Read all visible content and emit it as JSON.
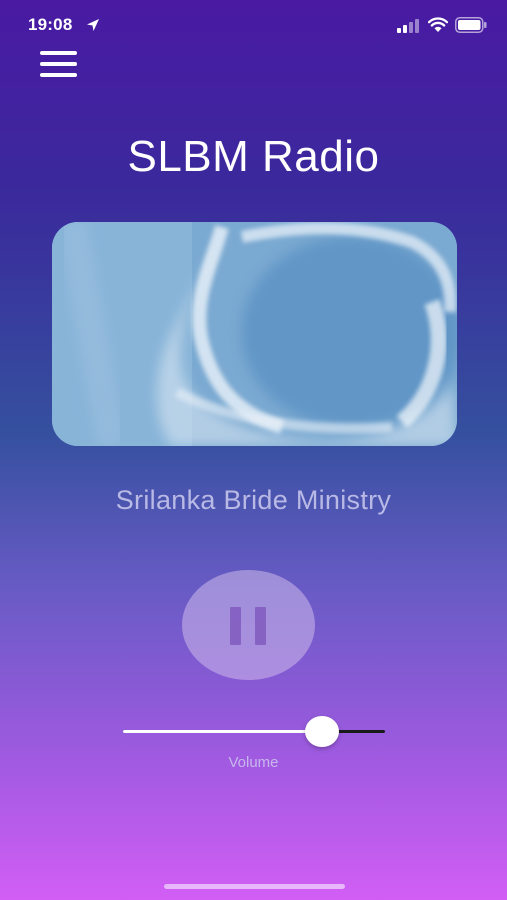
{
  "status_bar": {
    "time": "19:08",
    "location_icon": "location-arrow-icon",
    "signal_icon": "cellular-signal-icon",
    "wifi_icon": "wifi-icon",
    "battery_icon": "battery-icon"
  },
  "header": {
    "menu_icon": "hamburger-menu-icon",
    "title": "SLBM Radio"
  },
  "player": {
    "artwork_description": "sky with clouds",
    "station_name": "Srilanka Bride Ministry",
    "playback_state": "playing",
    "pause_icon": "pause-icon"
  },
  "volume": {
    "label": "Volume",
    "level": 0.76
  },
  "colors": {
    "background_top": "#4a1aa3",
    "background_bottom": "#d25ef5",
    "title_text": "#ffffff",
    "station_text": "#b9b9e6",
    "pause_button_bg": "#cdb9eb",
    "pause_icon": "#805abe"
  }
}
